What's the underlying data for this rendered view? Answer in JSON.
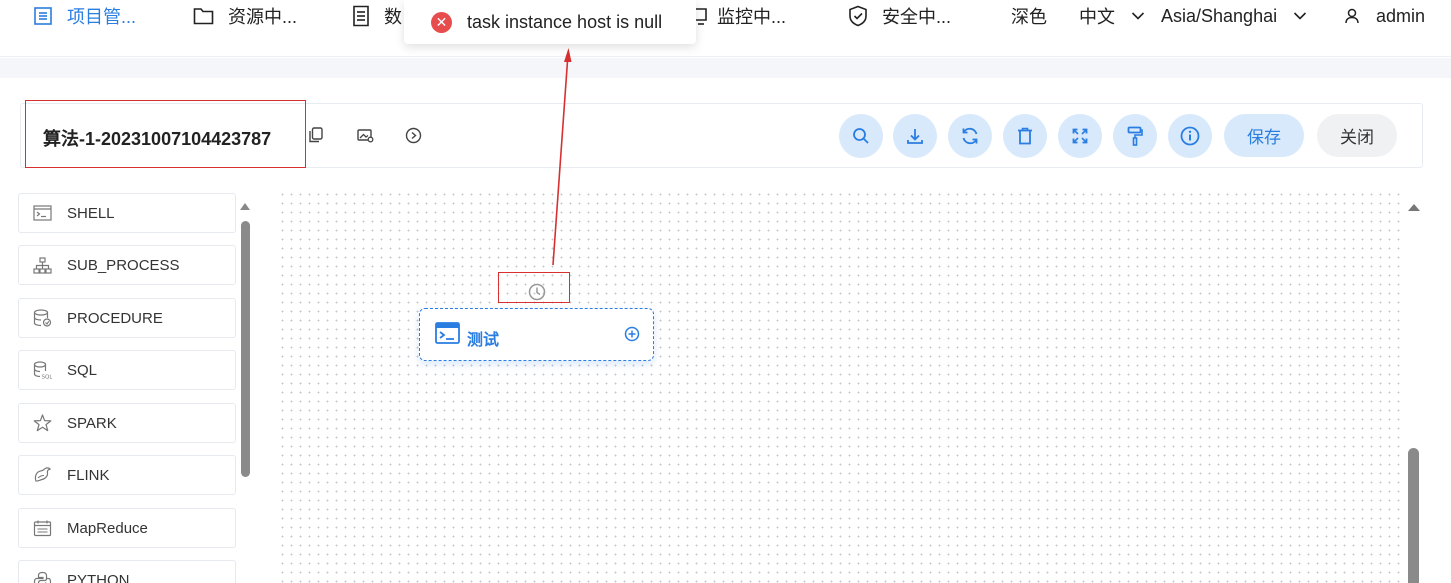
{
  "nav": {
    "project": "项目管...",
    "resource": "资源中...",
    "data": "数",
    "monitor": "监控中...",
    "security": "安全中...",
    "theme": "深色",
    "language": "中文",
    "timezone": "Asia/Shanghai",
    "user": "admin"
  },
  "toast": {
    "message": "task instance host is null"
  },
  "workflow": {
    "title": "算法-1-20231007104423787"
  },
  "toolbar": {
    "save_label": "保存",
    "close_label": "关闭"
  },
  "sidebar": {
    "items": [
      {
        "label": "SHELL",
        "icon": "shell-icon"
      },
      {
        "label": "SUB_PROCESS",
        "icon": "sub-process-icon"
      },
      {
        "label": "PROCEDURE",
        "icon": "procedure-icon"
      },
      {
        "label": "SQL",
        "icon": "sql-icon"
      },
      {
        "label": "SPARK",
        "icon": "spark-icon"
      },
      {
        "label": "FLINK",
        "icon": "flink-icon"
      },
      {
        "label": "MapReduce",
        "icon": "mapreduce-icon"
      },
      {
        "label": "PYTHON",
        "icon": "python-icon"
      }
    ]
  },
  "canvas": {
    "node_label": "测试"
  },
  "colors": {
    "accent": "#2a7de1",
    "error": "#e84d4d",
    "annotation": "#d63030"
  }
}
